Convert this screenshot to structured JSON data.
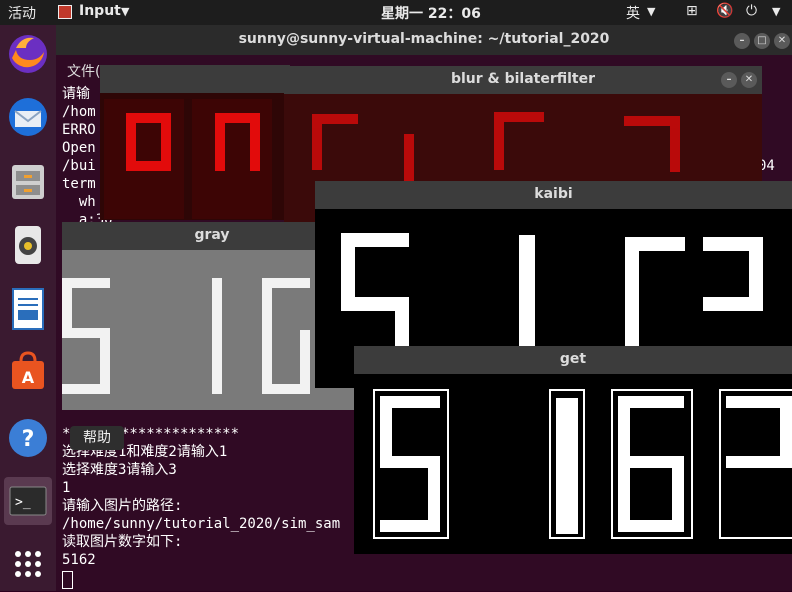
{
  "topbar": {
    "activities": "活动",
    "app_menu": "Input",
    "clock": "星期一 22：06",
    "input_method": "英"
  },
  "dock": {
    "items": [
      "firefox-icon",
      "thunderbird-icon",
      "files-icon",
      "rhythmbox-icon",
      "writer-icon",
      "software-icon",
      "help-icon",
      "terminal-icon",
      "apps-grid-icon"
    ]
  },
  "terminal": {
    "title": "sunny@sunny-virtual-machine: ~/tutorial_2020",
    "menu_partial": "文件(",
    "lines_top": [
      "请输",
      "/hom",
      "ERRO",
      "Open",
      "/bui",
      "term",
      "  wh",
      "  a:30"
    ],
    "right_fragment": "04",
    "lines_bottom": [
      "*********************",
      "选择难度1和难度2请输入1",
      "选择难度3请输入3",
      "1",
      "请输入图片的路径:",
      "/home/sunny/tutorial_2020/sim_sam",
      "读取图片数字如下:",
      "5162"
    ],
    "help_tooltip": "帮助"
  },
  "windows": {
    "blur": {
      "title": "blur & bilaterfilter"
    },
    "gray": {
      "title": "gray"
    },
    "kaibi": {
      "title": "kaibi"
    },
    "get": {
      "title": "get"
    }
  },
  "recognized_digits": "5162"
}
